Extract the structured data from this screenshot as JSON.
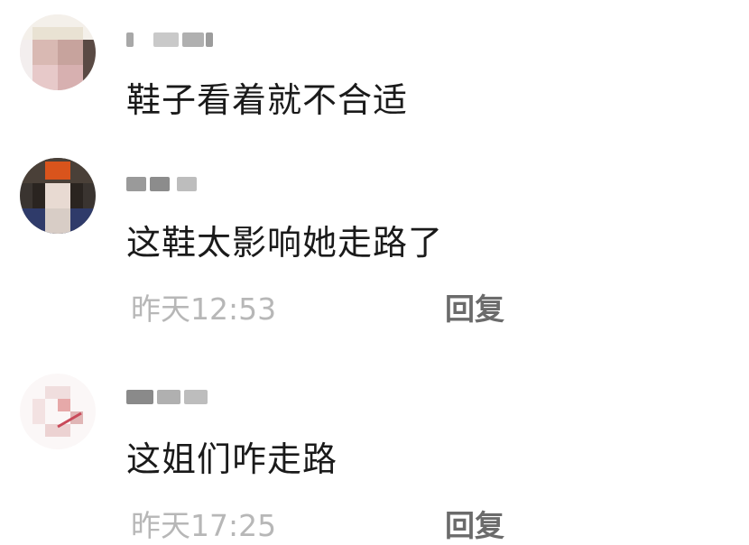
{
  "comments": [
    {
      "content": "鞋子看着就不合适"
    },
    {
      "content": "这鞋太影响她走路了",
      "time": "昨天12:53",
      "reply_label": "回复"
    },
    {
      "content": "这姐们咋走路",
      "time": "昨天17:25",
      "reply_label": "回复"
    }
  ]
}
